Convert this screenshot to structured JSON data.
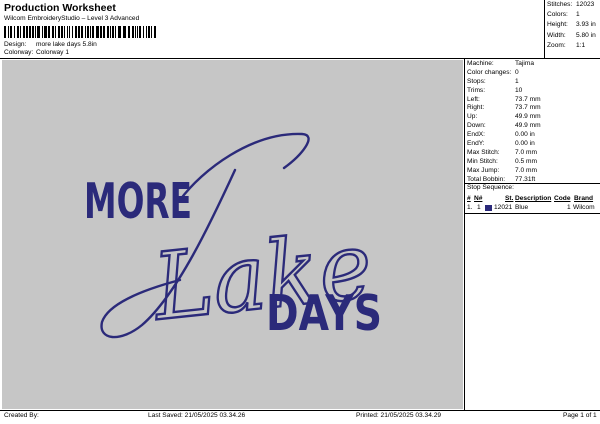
{
  "header": {
    "title": "Production Worksheet",
    "subtitle": "Wilcom EmbroideryStudio – Level 3 Advanced",
    "design_label": "Design:",
    "design_value": "more lake days 5.8in",
    "colorway_label": "Colorway:",
    "colorway_value": "Colorway 1"
  },
  "summary": [
    {
      "label": "Stitches:",
      "value": "12023"
    },
    {
      "label": "Colors:",
      "value": "1"
    },
    {
      "label": "Height:",
      "value": "3.93 in"
    },
    {
      "label": "Width:",
      "value": "5.80 in"
    },
    {
      "label": "Zoom:",
      "value": "1:1"
    }
  ],
  "machine_info": [
    {
      "label": "Machine:",
      "value": "Tajima"
    },
    {
      "label": "Color changes:",
      "value": "0"
    },
    {
      "label": "Stops:",
      "value": "1"
    },
    {
      "label": "Trims:",
      "value": "10"
    },
    {
      "label": "Left:",
      "value": "73.7 mm"
    },
    {
      "label": "Right:",
      "value": "73.7 mm"
    },
    {
      "label": "Up:",
      "value": "49.9 mm"
    },
    {
      "label": "Down:",
      "value": "49.9 mm"
    },
    {
      "label": "EndX:",
      "value": "0.00 in"
    },
    {
      "label": "EndY:",
      "value": "0.00 in"
    },
    {
      "label": "Max Stitch:",
      "value": "7.0 mm"
    },
    {
      "label": "Min Stitch:",
      "value": "0.5 mm"
    },
    {
      "label": "Max Jump:",
      "value": "7.0 mm"
    },
    {
      "label": "Total Bobbin:",
      "value": "77.31ft"
    }
  ],
  "stop_sequence": {
    "title": "Stop Sequence:",
    "columns": [
      "#",
      "N#",
      "St.",
      "Description",
      "Code",
      "Brand"
    ],
    "rows": [
      {
        "num": "1.",
        "needle": "1",
        "stitches": "12021",
        "description": "Blue",
        "code": "1",
        "brand": "Wilcom",
        "swatch_color": "#2b2a7a"
      }
    ]
  },
  "design_preview": {
    "background_color": "#c6c6c6",
    "thread_color": "#2b2a7a",
    "text_more": "MORE",
    "text_lake": "Lake",
    "text_days": "DAYS"
  },
  "footer": {
    "created_by": "Created By:",
    "last_saved": "Last Saved: 21/05/2025 03.34.26",
    "printed": "Printed: 21/05/2025 03.34.29",
    "page": "Page 1 of 1"
  }
}
